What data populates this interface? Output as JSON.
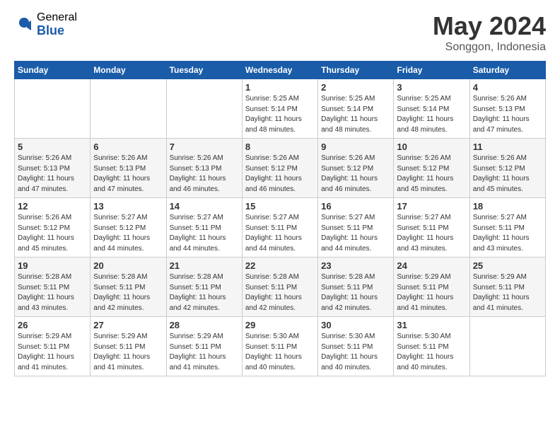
{
  "header": {
    "logo_general": "General",
    "logo_blue": "Blue",
    "month_title": "May 2024",
    "location": "Songgon, Indonesia"
  },
  "weekdays": [
    "Sunday",
    "Monday",
    "Tuesday",
    "Wednesday",
    "Thursday",
    "Friday",
    "Saturday"
  ],
  "weeks": [
    [
      {
        "day": "",
        "info": ""
      },
      {
        "day": "",
        "info": ""
      },
      {
        "day": "",
        "info": ""
      },
      {
        "day": "1",
        "info": "Sunrise: 5:25 AM\nSunset: 5:14 PM\nDaylight: 11 hours\nand 48 minutes."
      },
      {
        "day": "2",
        "info": "Sunrise: 5:25 AM\nSunset: 5:14 PM\nDaylight: 11 hours\nand 48 minutes."
      },
      {
        "day": "3",
        "info": "Sunrise: 5:25 AM\nSunset: 5:14 PM\nDaylight: 11 hours\nand 48 minutes."
      },
      {
        "day": "4",
        "info": "Sunrise: 5:26 AM\nSunset: 5:13 PM\nDaylight: 11 hours\nand 47 minutes."
      }
    ],
    [
      {
        "day": "5",
        "info": "Sunrise: 5:26 AM\nSunset: 5:13 PM\nDaylight: 11 hours\nand 47 minutes."
      },
      {
        "day": "6",
        "info": "Sunrise: 5:26 AM\nSunset: 5:13 PM\nDaylight: 11 hours\nand 47 minutes."
      },
      {
        "day": "7",
        "info": "Sunrise: 5:26 AM\nSunset: 5:13 PM\nDaylight: 11 hours\nand 46 minutes."
      },
      {
        "day": "8",
        "info": "Sunrise: 5:26 AM\nSunset: 5:12 PM\nDaylight: 11 hours\nand 46 minutes."
      },
      {
        "day": "9",
        "info": "Sunrise: 5:26 AM\nSunset: 5:12 PM\nDaylight: 11 hours\nand 46 minutes."
      },
      {
        "day": "10",
        "info": "Sunrise: 5:26 AM\nSunset: 5:12 PM\nDaylight: 11 hours\nand 45 minutes."
      },
      {
        "day": "11",
        "info": "Sunrise: 5:26 AM\nSunset: 5:12 PM\nDaylight: 11 hours\nand 45 minutes."
      }
    ],
    [
      {
        "day": "12",
        "info": "Sunrise: 5:26 AM\nSunset: 5:12 PM\nDaylight: 11 hours\nand 45 minutes."
      },
      {
        "day": "13",
        "info": "Sunrise: 5:27 AM\nSunset: 5:12 PM\nDaylight: 11 hours\nand 44 minutes."
      },
      {
        "day": "14",
        "info": "Sunrise: 5:27 AM\nSunset: 5:11 PM\nDaylight: 11 hours\nand 44 minutes."
      },
      {
        "day": "15",
        "info": "Sunrise: 5:27 AM\nSunset: 5:11 PM\nDaylight: 11 hours\nand 44 minutes."
      },
      {
        "day": "16",
        "info": "Sunrise: 5:27 AM\nSunset: 5:11 PM\nDaylight: 11 hours\nand 44 minutes."
      },
      {
        "day": "17",
        "info": "Sunrise: 5:27 AM\nSunset: 5:11 PM\nDaylight: 11 hours\nand 43 minutes."
      },
      {
        "day": "18",
        "info": "Sunrise: 5:27 AM\nSunset: 5:11 PM\nDaylight: 11 hours\nand 43 minutes."
      }
    ],
    [
      {
        "day": "19",
        "info": "Sunrise: 5:28 AM\nSunset: 5:11 PM\nDaylight: 11 hours\nand 43 minutes."
      },
      {
        "day": "20",
        "info": "Sunrise: 5:28 AM\nSunset: 5:11 PM\nDaylight: 11 hours\nand 42 minutes."
      },
      {
        "day": "21",
        "info": "Sunrise: 5:28 AM\nSunset: 5:11 PM\nDaylight: 11 hours\nand 42 minutes."
      },
      {
        "day": "22",
        "info": "Sunrise: 5:28 AM\nSunset: 5:11 PM\nDaylight: 11 hours\nand 42 minutes."
      },
      {
        "day": "23",
        "info": "Sunrise: 5:28 AM\nSunset: 5:11 PM\nDaylight: 11 hours\nand 42 minutes."
      },
      {
        "day": "24",
        "info": "Sunrise: 5:29 AM\nSunset: 5:11 PM\nDaylight: 11 hours\nand 41 minutes."
      },
      {
        "day": "25",
        "info": "Sunrise: 5:29 AM\nSunset: 5:11 PM\nDaylight: 11 hours\nand 41 minutes."
      }
    ],
    [
      {
        "day": "26",
        "info": "Sunrise: 5:29 AM\nSunset: 5:11 PM\nDaylight: 11 hours\nand 41 minutes."
      },
      {
        "day": "27",
        "info": "Sunrise: 5:29 AM\nSunset: 5:11 PM\nDaylight: 11 hours\nand 41 minutes."
      },
      {
        "day": "28",
        "info": "Sunrise: 5:29 AM\nSunset: 5:11 PM\nDaylight: 11 hours\nand 41 minutes."
      },
      {
        "day": "29",
        "info": "Sunrise: 5:30 AM\nSunset: 5:11 PM\nDaylight: 11 hours\nand 40 minutes."
      },
      {
        "day": "30",
        "info": "Sunrise: 5:30 AM\nSunset: 5:11 PM\nDaylight: 11 hours\nand 40 minutes."
      },
      {
        "day": "31",
        "info": "Sunrise: 5:30 AM\nSunset: 5:11 PM\nDaylight: 11 hours\nand 40 minutes."
      },
      {
        "day": "",
        "info": ""
      }
    ]
  ]
}
